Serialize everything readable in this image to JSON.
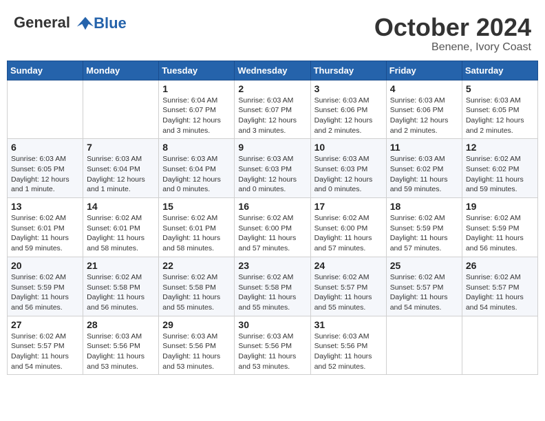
{
  "header": {
    "logo_general": "General",
    "logo_blue": "Blue",
    "month": "October 2024",
    "location": "Benene, Ivory Coast"
  },
  "weekdays": [
    "Sunday",
    "Monday",
    "Tuesday",
    "Wednesday",
    "Thursday",
    "Friday",
    "Saturday"
  ],
  "weeks": [
    [
      {
        "day": "",
        "info": ""
      },
      {
        "day": "",
        "info": ""
      },
      {
        "day": "1",
        "info": "Sunrise: 6:04 AM\nSunset: 6:07 PM\nDaylight: 12 hours and 3 minutes."
      },
      {
        "day": "2",
        "info": "Sunrise: 6:03 AM\nSunset: 6:07 PM\nDaylight: 12 hours and 3 minutes."
      },
      {
        "day": "3",
        "info": "Sunrise: 6:03 AM\nSunset: 6:06 PM\nDaylight: 12 hours and 2 minutes."
      },
      {
        "day": "4",
        "info": "Sunrise: 6:03 AM\nSunset: 6:06 PM\nDaylight: 12 hours and 2 minutes."
      },
      {
        "day": "5",
        "info": "Sunrise: 6:03 AM\nSunset: 6:05 PM\nDaylight: 12 hours and 2 minutes."
      }
    ],
    [
      {
        "day": "6",
        "info": "Sunrise: 6:03 AM\nSunset: 6:05 PM\nDaylight: 12 hours and 1 minute."
      },
      {
        "day": "7",
        "info": "Sunrise: 6:03 AM\nSunset: 6:04 PM\nDaylight: 12 hours and 1 minute."
      },
      {
        "day": "8",
        "info": "Sunrise: 6:03 AM\nSunset: 6:04 PM\nDaylight: 12 hours and 0 minutes."
      },
      {
        "day": "9",
        "info": "Sunrise: 6:03 AM\nSunset: 6:03 PM\nDaylight: 12 hours and 0 minutes."
      },
      {
        "day": "10",
        "info": "Sunrise: 6:03 AM\nSunset: 6:03 PM\nDaylight: 12 hours and 0 minutes."
      },
      {
        "day": "11",
        "info": "Sunrise: 6:03 AM\nSunset: 6:02 PM\nDaylight: 11 hours and 59 minutes."
      },
      {
        "day": "12",
        "info": "Sunrise: 6:02 AM\nSunset: 6:02 PM\nDaylight: 11 hours and 59 minutes."
      }
    ],
    [
      {
        "day": "13",
        "info": "Sunrise: 6:02 AM\nSunset: 6:01 PM\nDaylight: 11 hours and 59 minutes."
      },
      {
        "day": "14",
        "info": "Sunrise: 6:02 AM\nSunset: 6:01 PM\nDaylight: 11 hours and 58 minutes."
      },
      {
        "day": "15",
        "info": "Sunrise: 6:02 AM\nSunset: 6:01 PM\nDaylight: 11 hours and 58 minutes."
      },
      {
        "day": "16",
        "info": "Sunrise: 6:02 AM\nSunset: 6:00 PM\nDaylight: 11 hours and 57 minutes."
      },
      {
        "day": "17",
        "info": "Sunrise: 6:02 AM\nSunset: 6:00 PM\nDaylight: 11 hours and 57 minutes."
      },
      {
        "day": "18",
        "info": "Sunrise: 6:02 AM\nSunset: 5:59 PM\nDaylight: 11 hours and 57 minutes."
      },
      {
        "day": "19",
        "info": "Sunrise: 6:02 AM\nSunset: 5:59 PM\nDaylight: 11 hours and 56 minutes."
      }
    ],
    [
      {
        "day": "20",
        "info": "Sunrise: 6:02 AM\nSunset: 5:59 PM\nDaylight: 11 hours and 56 minutes."
      },
      {
        "day": "21",
        "info": "Sunrise: 6:02 AM\nSunset: 5:58 PM\nDaylight: 11 hours and 56 minutes."
      },
      {
        "day": "22",
        "info": "Sunrise: 6:02 AM\nSunset: 5:58 PM\nDaylight: 11 hours and 55 minutes."
      },
      {
        "day": "23",
        "info": "Sunrise: 6:02 AM\nSunset: 5:58 PM\nDaylight: 11 hours and 55 minutes."
      },
      {
        "day": "24",
        "info": "Sunrise: 6:02 AM\nSunset: 5:57 PM\nDaylight: 11 hours and 55 minutes."
      },
      {
        "day": "25",
        "info": "Sunrise: 6:02 AM\nSunset: 5:57 PM\nDaylight: 11 hours and 54 minutes."
      },
      {
        "day": "26",
        "info": "Sunrise: 6:02 AM\nSunset: 5:57 PM\nDaylight: 11 hours and 54 minutes."
      }
    ],
    [
      {
        "day": "27",
        "info": "Sunrise: 6:02 AM\nSunset: 5:57 PM\nDaylight: 11 hours and 54 minutes."
      },
      {
        "day": "28",
        "info": "Sunrise: 6:03 AM\nSunset: 5:56 PM\nDaylight: 11 hours and 53 minutes."
      },
      {
        "day": "29",
        "info": "Sunrise: 6:03 AM\nSunset: 5:56 PM\nDaylight: 11 hours and 53 minutes."
      },
      {
        "day": "30",
        "info": "Sunrise: 6:03 AM\nSunset: 5:56 PM\nDaylight: 11 hours and 53 minutes."
      },
      {
        "day": "31",
        "info": "Sunrise: 6:03 AM\nSunset: 5:56 PM\nDaylight: 11 hours and 52 minutes."
      },
      {
        "day": "",
        "info": ""
      },
      {
        "day": "",
        "info": ""
      }
    ]
  ]
}
